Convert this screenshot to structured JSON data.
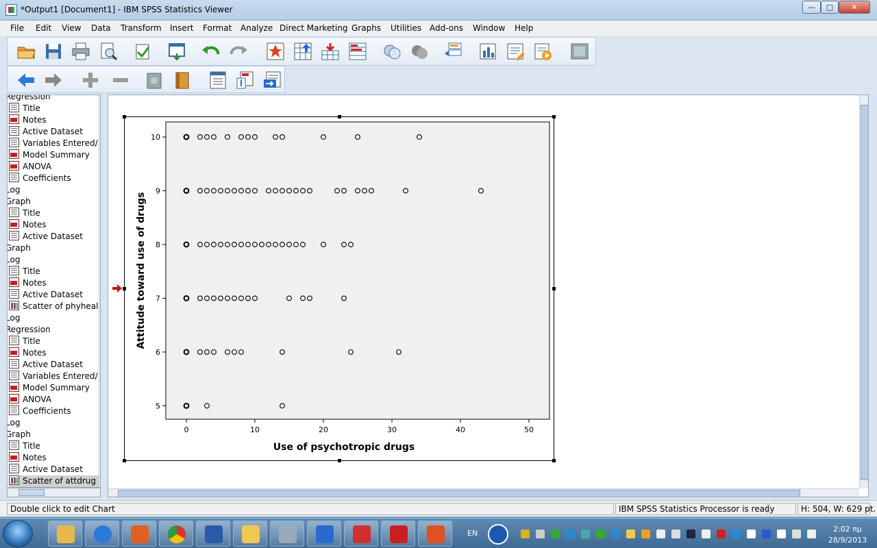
{
  "window": {
    "title": "*Output1 [Document1] - IBM SPSS Statistics Viewer",
    "minimize": "—",
    "maximize": "□",
    "close": "✕"
  },
  "menu": [
    "File",
    "Edit",
    "View",
    "Data",
    "Transform",
    "Insert",
    "Format",
    "Analyze",
    "Direct Marketing",
    "Graphs",
    "Utilities",
    "Add-ons",
    "Window",
    "Help"
  ],
  "outline": {
    "items": [
      {
        "label": "Regression",
        "kind": "heading"
      },
      {
        "label": "Title",
        "kind": "table"
      },
      {
        "label": "Notes",
        "kind": "notes"
      },
      {
        "label": "Active Dataset",
        "kind": "table"
      },
      {
        "label": "Variables Entered/",
        "kind": "table"
      },
      {
        "label": "Model Summary",
        "kind": "notes"
      },
      {
        "label": "ANOVA",
        "kind": "notes"
      },
      {
        "label": "Coefficients",
        "kind": "table"
      },
      {
        "label": "Log",
        "kind": "heading"
      },
      {
        "label": "Graph",
        "kind": "heading"
      },
      {
        "label": "Title",
        "kind": "table"
      },
      {
        "label": "Notes",
        "kind": "notes"
      },
      {
        "label": "Active Dataset",
        "kind": "table"
      },
      {
        "label": "Graph",
        "kind": "heading"
      },
      {
        "label": "Log",
        "kind": "heading"
      },
      {
        "label": "Title",
        "kind": "table"
      },
      {
        "label": "Notes",
        "kind": "notes"
      },
      {
        "label": "Active Dataset",
        "kind": "table"
      },
      {
        "label": "Scatter of phyheal",
        "kind": "chart"
      },
      {
        "label": "Log",
        "kind": "heading"
      },
      {
        "label": "Regression",
        "kind": "heading"
      },
      {
        "label": "Title",
        "kind": "table"
      },
      {
        "label": "Notes",
        "kind": "notes"
      },
      {
        "label": "Active Dataset",
        "kind": "table"
      },
      {
        "label": "Variables Entered/",
        "kind": "table"
      },
      {
        "label": "Model Summary",
        "kind": "notes"
      },
      {
        "label": "ANOVA",
        "kind": "notes"
      },
      {
        "label": "Coefficients",
        "kind": "table"
      },
      {
        "label": "Log",
        "kind": "heading"
      },
      {
        "label": "Graph",
        "kind": "heading"
      },
      {
        "label": "Title",
        "kind": "table"
      },
      {
        "label": "Notes",
        "kind": "notes"
      },
      {
        "label": "Active Dataset",
        "kind": "table"
      },
      {
        "label": "Scatter of attdrug p",
        "kind": "chart",
        "selected": true
      }
    ]
  },
  "status": {
    "hint": "Double click to edit Chart",
    "processor": "IBM SPSS Statistics Processor is ready",
    "size": "H: 504, W: 629 pt."
  },
  "taskbar": {
    "lang": "EN",
    "time": "2:02 πμ",
    "date": "28/9/2013"
  },
  "colors": {
    "plot_bg": "#f0f0f0",
    "marker": "#000000",
    "selection_arrow": "#d01010"
  },
  "chart_data": {
    "type": "scatter",
    "xlabel": "Use of psychotropic drugs",
    "ylabel": "Attitude toward use of drugs",
    "xlim": [
      -3,
      53
    ],
    "ylim": [
      4.75,
      10.28
    ],
    "x_ticks": [
      0,
      10,
      20,
      30,
      40,
      50
    ],
    "y_ticks": [
      5,
      6,
      7,
      8,
      9,
      10
    ],
    "grid": false,
    "points": [
      [
        0,
        10
      ],
      [
        2,
        10
      ],
      [
        3,
        10
      ],
      [
        4,
        10
      ],
      [
        6,
        10
      ],
      [
        8,
        10
      ],
      [
        9,
        10
      ],
      [
        10,
        10
      ],
      [
        13,
        10
      ],
      [
        14,
        10
      ],
      [
        20,
        10
      ],
      [
        25,
        10
      ],
      [
        34,
        10
      ],
      [
        0,
        9
      ],
      [
        2,
        9
      ],
      [
        3,
        9
      ],
      [
        4,
        9
      ],
      [
        5,
        9
      ],
      [
        6,
        9
      ],
      [
        7,
        9
      ],
      [
        8,
        9
      ],
      [
        9,
        9
      ],
      [
        10,
        9
      ],
      [
        12,
        9
      ],
      [
        13,
        9
      ],
      [
        14,
        9
      ],
      [
        15,
        9
      ],
      [
        16,
        9
      ],
      [
        17,
        9
      ],
      [
        18,
        9
      ],
      [
        22,
        9
      ],
      [
        23,
        9
      ],
      [
        25,
        9
      ],
      [
        26,
        9
      ],
      [
        27,
        9
      ],
      [
        32,
        9
      ],
      [
        43,
        9
      ],
      [
        0,
        8
      ],
      [
        2,
        8
      ],
      [
        3,
        8
      ],
      [
        4,
        8
      ],
      [
        5,
        8
      ],
      [
        6,
        8
      ],
      [
        7,
        8
      ],
      [
        8,
        8
      ],
      [
        9,
        8
      ],
      [
        10,
        8
      ],
      [
        11,
        8
      ],
      [
        12,
        8
      ],
      [
        13,
        8
      ],
      [
        14,
        8
      ],
      [
        15,
        8
      ],
      [
        16,
        8
      ],
      [
        17,
        8
      ],
      [
        20,
        8
      ],
      [
        23,
        8
      ],
      [
        24,
        8
      ],
      [
        0,
        7
      ],
      [
        2,
        7
      ],
      [
        3,
        7
      ],
      [
        4,
        7
      ],
      [
        5,
        7
      ],
      [
        6,
        7
      ],
      [
        7,
        7
      ],
      [
        8,
        7
      ],
      [
        9,
        7
      ],
      [
        10,
        7
      ],
      [
        15,
        7
      ],
      [
        17,
        7
      ],
      [
        18,
        7
      ],
      [
        23,
        7
      ],
      [
        0,
        6
      ],
      [
        2,
        6
      ],
      [
        3,
        6
      ],
      [
        4,
        6
      ],
      [
        6,
        6
      ],
      [
        7,
        6
      ],
      [
        8,
        6
      ],
      [
        14,
        6
      ],
      [
        24,
        6
      ],
      [
        31,
        6
      ],
      [
        0,
        5
      ],
      [
        3,
        5
      ],
      [
        14,
        5
      ]
    ]
  }
}
